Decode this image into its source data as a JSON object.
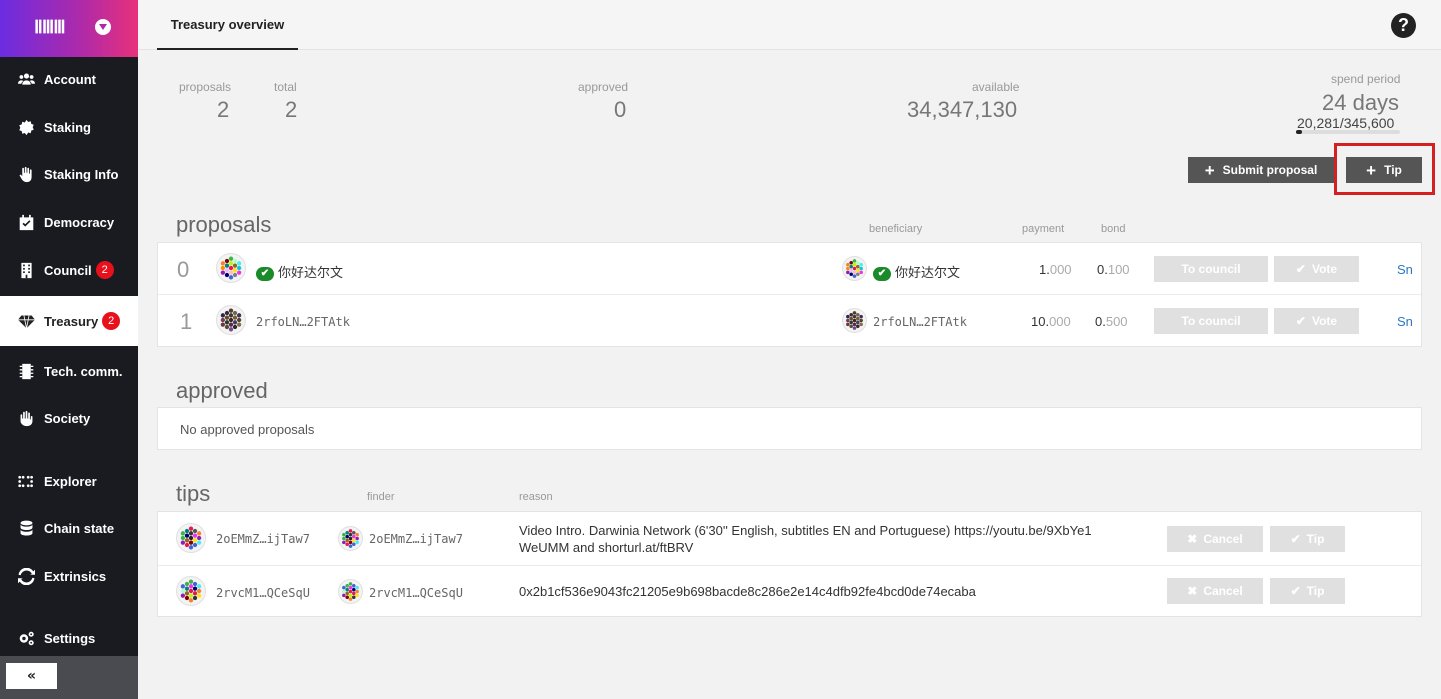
{
  "app": {
    "logo_text": "ⅡⅢⅢ"
  },
  "sidebar": {
    "items": [
      {
        "label": "Account",
        "icon": "users-icon"
      },
      {
        "label": "Staking",
        "icon": "certificate-icon"
      },
      {
        "label": "Staking Info",
        "icon": "hand-icon"
      },
      {
        "label": "Democracy",
        "icon": "calendar-check-icon"
      },
      {
        "label": "Council",
        "icon": "building-icon",
        "badge": "2"
      },
      {
        "label": "Treasury",
        "icon": "gem-icon",
        "badge": "2",
        "active": true
      },
      {
        "label": "Tech. comm.",
        "icon": "microchip-icon"
      },
      {
        "label": "Society",
        "icon": "hand-paper-icon"
      },
      {
        "label": "Explorer",
        "icon": "braille-icon"
      },
      {
        "label": "Chain state",
        "icon": "database-icon"
      },
      {
        "label": "Extrinsics",
        "icon": "sync-icon"
      },
      {
        "label": "Settings",
        "icon": "cogs-icon"
      }
    ],
    "collapse_label": "«"
  },
  "header": {
    "tab": "Treasury overview",
    "help": "?"
  },
  "summary": {
    "proposals_label": "proposals",
    "proposals_value": "2",
    "total_label": "total",
    "total_value": "2",
    "approved_label": "approved",
    "approved_value": "0",
    "available_label": "available",
    "available_value": "34,347,130",
    "spend_label": "spend period",
    "spend_value": "24 days",
    "spend_progress": "20,281/345,600",
    "spend_fraction": 0.0587
  },
  "actions": {
    "submit_label": "Submit proposal",
    "tip_label": "Tip"
  },
  "proposals": {
    "title": "proposals",
    "col_beneficiary": "beneficiary",
    "col_payment": "payment",
    "col_bond": "bond",
    "rows": [
      {
        "index": "0",
        "proposer": "你好达尔文",
        "beneficiary": "你好达尔文",
        "verified": true,
        "pay_hi": "1.",
        "pay_lo": "000",
        "bond_hi": "0.",
        "bond_lo": "100",
        "council_label": "To council",
        "vote_label": "Vote",
        "link": "Sn"
      },
      {
        "index": "1",
        "proposer": "2rfoLN…2FTAtk",
        "beneficiary": "2rfoLN…2FTAtk",
        "verified": false,
        "pay_hi": "10.",
        "pay_lo": "000",
        "bond_hi": "0.",
        "bond_lo": "500",
        "council_label": "To council",
        "vote_label": "Vote",
        "link": "Sn"
      }
    ]
  },
  "approved": {
    "title": "approved",
    "empty": "No approved proposals"
  },
  "tips": {
    "title": "tips",
    "col_finder": "finder",
    "col_reason": "reason",
    "rows": [
      {
        "who": "2oEMmZ…ijTaw7",
        "finder": "2oEMmZ…ijTaw7",
        "reason_1": "Video Intro. Darwinia Network (6'30'' English, subtitles EN and Portuguese) https://youtu.be/9XbYe1",
        "reason_2": "WeUMM and shorturl.at/ftBRV",
        "cancel_label": "Cancel",
        "tip_label": "Tip"
      },
      {
        "who": "2rvcM1…QCeSqU",
        "finder": "2rvcM1…QCeSqU",
        "reason_1": "0x2b1cf536e9043fc21205e9b698bacde8c286e2e14c4dfb92fe4bcd0de74ecaba",
        "reason_2": "",
        "cancel_label": "Cancel",
        "tip_label": "Tip"
      }
    ]
  }
}
